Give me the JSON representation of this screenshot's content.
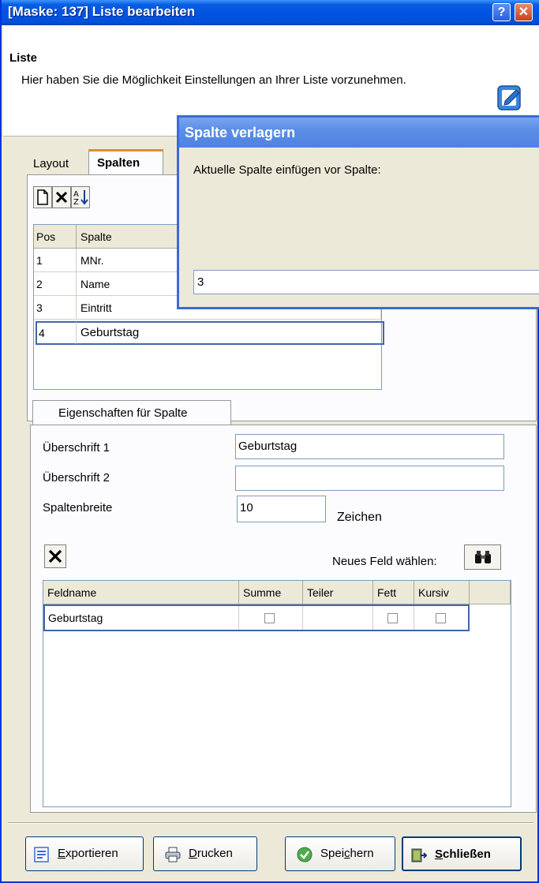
{
  "window": {
    "title": "[Maske: 137] Liste bearbeiten",
    "help_glyph": "?",
    "close_glyph": "✕"
  },
  "header": {
    "title": "Liste",
    "description": "Hier haben Sie die Möglichkeit Einstellungen an Ihrer Liste vorzunehmen."
  },
  "tabs": [
    {
      "label": "Layout"
    },
    {
      "label": "Spalten"
    }
  ],
  "columns_grid": {
    "headers": [
      "Pos",
      "Spalte"
    ],
    "rows": [
      {
        "pos": "1",
        "name": "MNr."
      },
      {
        "pos": "2",
        "name": "Name"
      },
      {
        "pos": "3",
        "name": "Eintritt"
      },
      {
        "pos": "4",
        "name": "Geburtstag"
      }
    ]
  },
  "properties": {
    "tab_label": "Eigenschaften für Spalte",
    "heading1_label": "Überschrift 1",
    "heading1_value": "Geburtstag",
    "heading2_label": "Überschrift 2",
    "heading2_value": "",
    "width_label": "Spaltenbreite",
    "width_value": "10",
    "width_unit": "Zeichen",
    "new_field_label": "Neues Feld wählen:",
    "field_grid": {
      "headers": [
        "Feldname",
        "Summe",
        "Teiler",
        "Fett",
        "Kursiv"
      ],
      "rows": [
        {
          "name": "Geburtstag",
          "summe": false,
          "fett": false,
          "kursiv": false
        }
      ]
    }
  },
  "buttons": {
    "export_key": "E",
    "export_rest": "xportieren",
    "print_key": "D",
    "print_rest": "rucken",
    "save_pre": "Spei",
    "save_key": "c",
    "save_post": "hern",
    "close_key": "S",
    "close_rest": "chließen"
  },
  "dialog": {
    "title": "Spalte verlagern",
    "prompt": "Aktuelle Spalte einfügen vor Spalte:",
    "value": "3"
  },
  "icons": [
    "new-icon",
    "delete-icon",
    "sort-az-icon",
    "binoculars-icon",
    "export-icon",
    "print-icon",
    "save-icon",
    "exit-icon",
    "edit-list-icon"
  ],
  "colors": {
    "titlebar": "#0054e3",
    "dialog_title": "#5c8ee6",
    "window_bg": "#ece9d8",
    "frame": "#0831d9"
  }
}
